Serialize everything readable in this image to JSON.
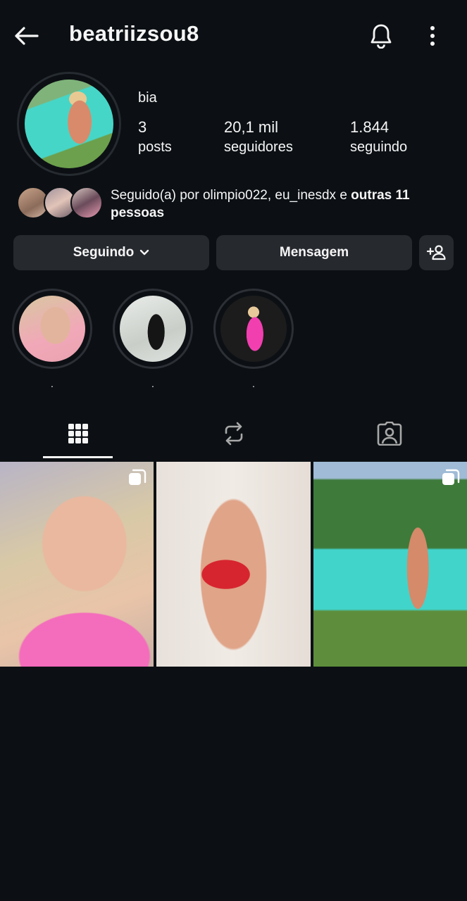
{
  "header": {
    "username": "beatriizsou8"
  },
  "profile": {
    "display_name": "bia",
    "stats": {
      "posts_count": "3",
      "posts_label": "posts",
      "followers_count": "20,1 mil",
      "followers_label": "seguidores",
      "following_count": "1.844",
      "following_label": "seguindo"
    },
    "mutuals": {
      "text_prefix": "Seguido(a) por olimpio022, eu_inesdx e ",
      "text_bold": "outras 11 pessoas"
    }
  },
  "actions": {
    "following_label": "Seguindo",
    "message_label": "Mensagem"
  },
  "highlights": [
    {
      "label": "."
    },
    {
      "label": "."
    },
    {
      "label": "."
    }
  ],
  "tabs": {
    "grid_icon": "grid-icon",
    "reels_icon": "reels-icon",
    "tagged_icon": "tagged-icon",
    "active": "grid"
  },
  "colors": {
    "background": "#0c1014",
    "button": "#26292e",
    "text": "#f5f5f5"
  }
}
